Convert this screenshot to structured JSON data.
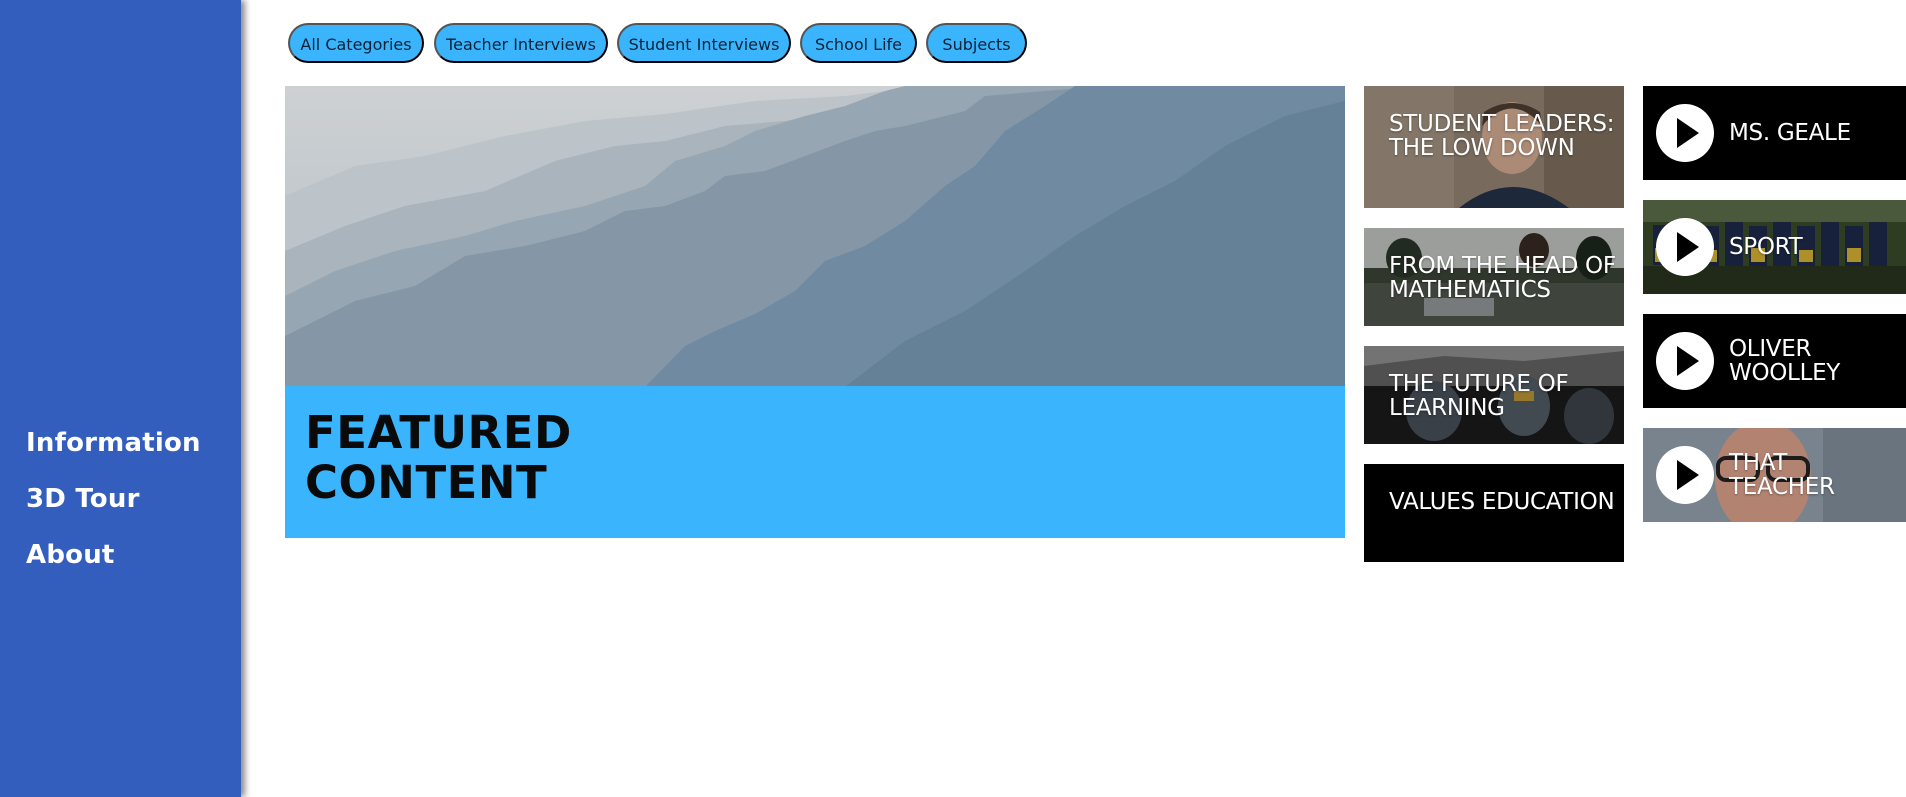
{
  "sidebar": {
    "items": [
      {
        "label": "Information",
        "icon": ""
      },
      {
        "label": "3D Tour",
        "icon": ""
      },
      {
        "label": "About",
        "icon": ""
      }
    ]
  },
  "categories": [
    {
      "label": "All Categories"
    },
    {
      "label": "Teacher Interviews"
    },
    {
      "label": "Student Interviews"
    },
    {
      "label": "School Life"
    },
    {
      "label": "Subjects"
    }
  ],
  "featured": {
    "title": "FEATURED CONTENT",
    "image": "mountain-ridges-image"
  },
  "articles": [
    {
      "title": "STUDENT LEADERS: THE LOW DOWN",
      "image": "student-photo"
    },
    {
      "title": "FROM THE HEAD OF MATHEMATICS",
      "image": "classroom-photo"
    },
    {
      "title": "THE FUTURE OF LEARNING",
      "image": "students-vr-photo"
    },
    {
      "title": "VALUES EDUCATION",
      "image": ""
    }
  ],
  "videos": [
    {
      "title": "MS. GEALE",
      "icon": "play-icon"
    },
    {
      "title": "SPORT",
      "icon": "play-icon"
    },
    {
      "title": "OLIVER WOOLLEY",
      "icon": "play-icon"
    },
    {
      "title": "THAT TEACHER",
      "icon": "play-icon"
    }
  ],
  "colors": {
    "sidebar": "#335ebd",
    "accent": "#3ab5fd",
    "tile_dark": "#000000"
  }
}
